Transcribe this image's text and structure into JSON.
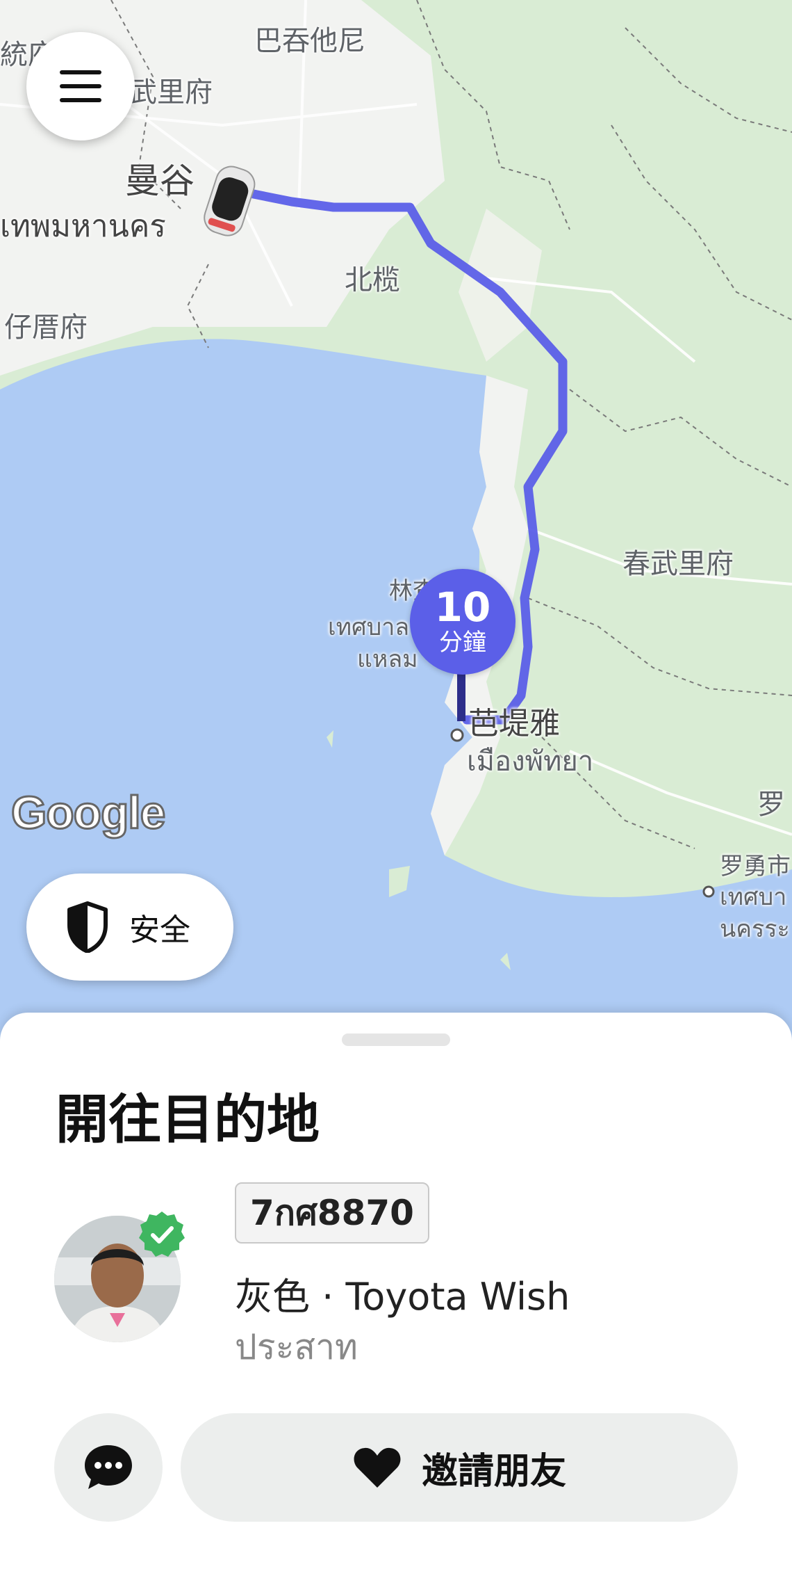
{
  "map": {
    "labels": {
      "nonthaburi_partial": "統府",
      "pathum_thani": "巴吞他尼",
      "nonthaburi": "武里府",
      "bangkok": "曼谷",
      "bangkok_th": "เทพมหานคร",
      "bang_na": "北榄",
      "samut_sakhon": "仔厝府",
      "chonburi": "春武里府",
      "laem_chabang": "林查",
      "laem_chabang_th1": "เทศบาล",
      "laem_chabang_th2": "แหลม",
      "pattaya": "芭堤雅",
      "pattaya_th": "เมืองพัทยา",
      "rayong_partial": "罗",
      "rayong_city": "罗勇市",
      "rayong_th1": "เทศบา",
      "rayong_th2": "นครระ"
    },
    "google_logo": "Google",
    "eta": {
      "value": "10",
      "unit": "分鐘"
    },
    "route_color": "#5b5fe8"
  },
  "buttons": {
    "menu_icon": "hamburger-icon",
    "safety_label": "安全",
    "safety_icon": "shield-icon",
    "chat_icon": "chat-bubble-icon",
    "invite_label": "邀請朋友",
    "invite_icon": "heart-icon"
  },
  "trip": {
    "status_title": "開往目的地",
    "plate": "7กศ8870",
    "vehicle": "灰色 · Toyota Wish",
    "driver_name": "ประสาท",
    "verified_icon": "verified-badge-icon"
  }
}
